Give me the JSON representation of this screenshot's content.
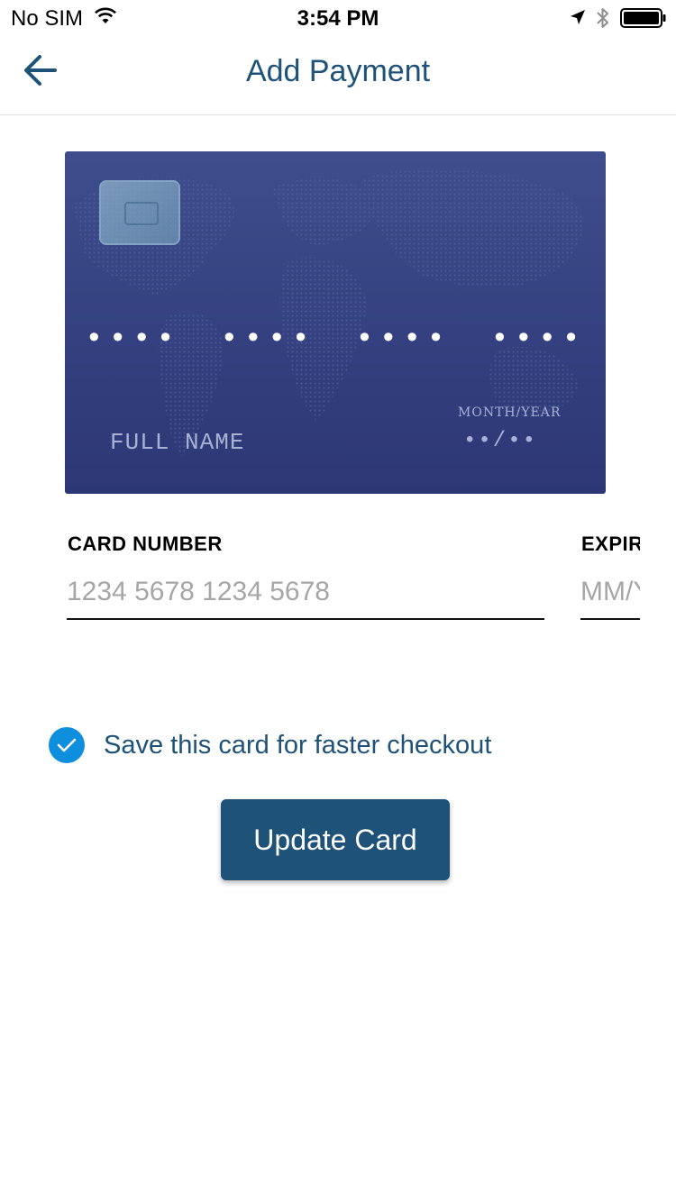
{
  "status_bar": {
    "carrier": "No SIM",
    "time": "3:54 PM",
    "icons": [
      "wifi-icon",
      "location-arrow-icon",
      "bluetooth-icon",
      "battery-icon"
    ]
  },
  "nav": {
    "back_icon": "arrow-left-icon",
    "title": "Add Payment"
  },
  "card_preview": {
    "number_mask": "•••• •••• •••• ••••",
    "name_placeholder": "FULL NAME",
    "expiry_label": "MONTH/YEAR",
    "expiry_mask": "••/••"
  },
  "form": {
    "card_number_label": "CARD NUMBER",
    "card_number_value": "",
    "card_number_placeholder": "1234 5678 1234 5678",
    "expiry_label": "EXPIRY",
    "expiry_value": "",
    "expiry_placeholder": "MM/YY"
  },
  "save_option": {
    "label": "Save this card for faster checkout",
    "checked": true
  },
  "actions": {
    "update_label": "Update Card"
  },
  "colors": {
    "primary": "#1e5278",
    "checkbox": "#0d8fde",
    "card_background": "#34407f",
    "placeholder": "#a6a6a6"
  }
}
